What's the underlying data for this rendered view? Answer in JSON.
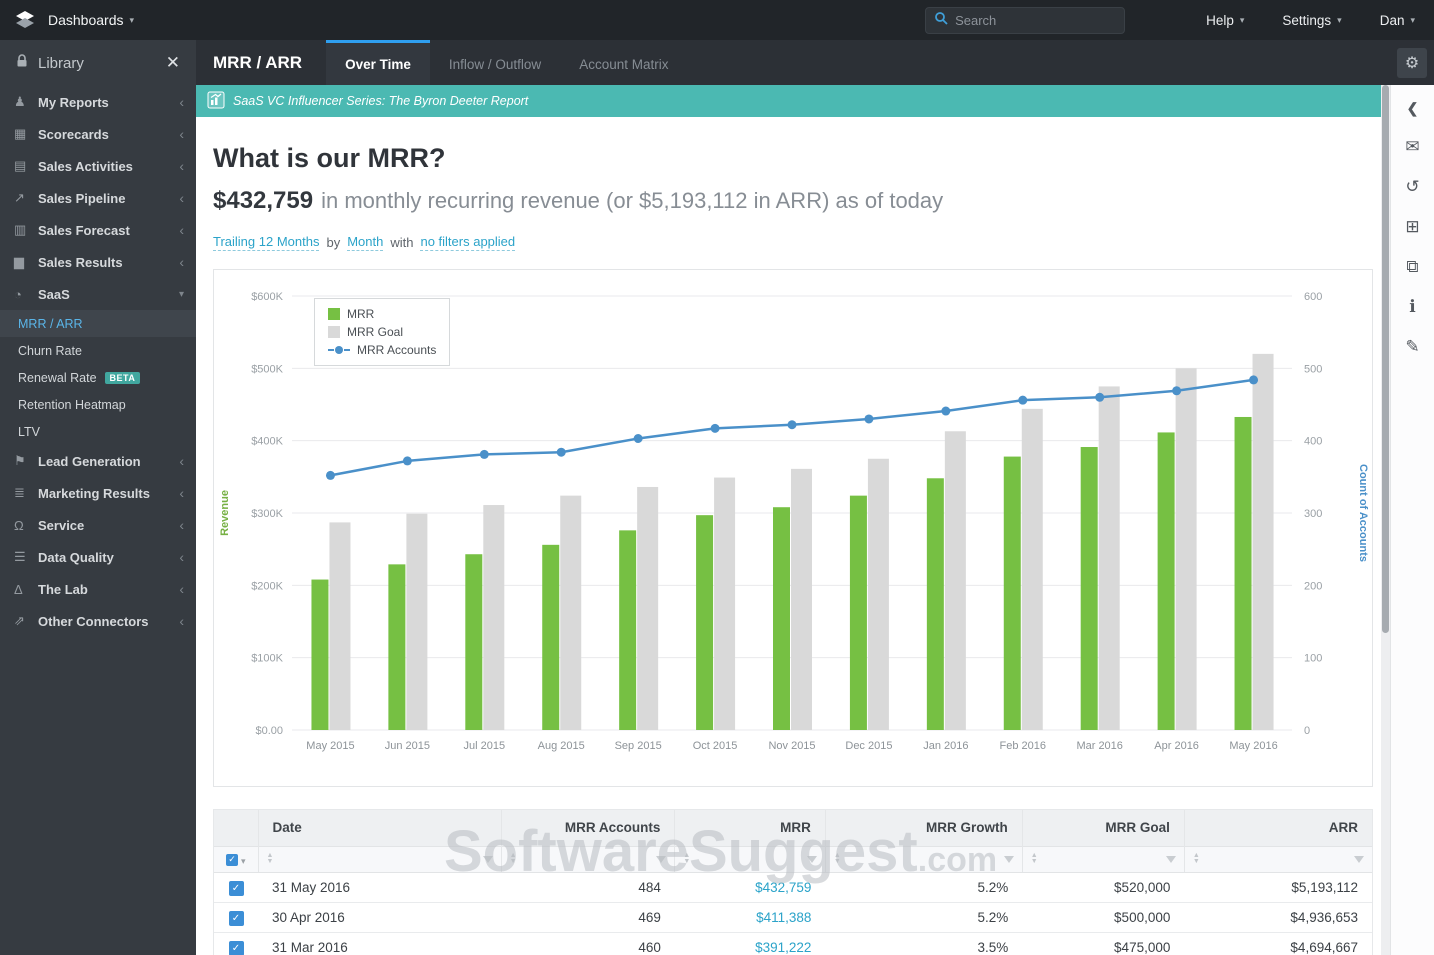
{
  "topbar": {
    "brand": "Dashboards",
    "search_placeholder": "Search",
    "links": [
      "Help",
      "Settings",
      "Dan"
    ]
  },
  "sidebar": {
    "header": "Library",
    "items_top": [
      {
        "label": "My Reports",
        "icon": "reports"
      },
      {
        "label": "Scorecards",
        "icon": "scorecards"
      },
      {
        "label": "Sales Activities",
        "icon": "activities"
      },
      {
        "label": "Sales Pipeline",
        "icon": "pipeline"
      },
      {
        "label": "Sales Forecast",
        "icon": "forecast"
      },
      {
        "label": "Sales Results",
        "icon": "results"
      }
    ],
    "saas_parent": {
      "label": "SaaS",
      "icon": "saas"
    },
    "saas_children": [
      {
        "label": "MRR / ARR",
        "selected": true
      },
      {
        "label": "Churn Rate"
      },
      {
        "label": "Renewal Rate",
        "badge": "BETA"
      },
      {
        "label": "Retention Heatmap"
      },
      {
        "label": "LTV"
      }
    ],
    "items_bottom": [
      {
        "label": "Lead Generation",
        "icon": "lead-generation"
      },
      {
        "label": "Marketing Results",
        "icon": "marketing"
      },
      {
        "label": "Service",
        "icon": "service"
      },
      {
        "label": "Data Quality",
        "icon": "data-quality"
      },
      {
        "label": "The Lab",
        "icon": "lab"
      },
      {
        "label": "Other Connectors",
        "icon": "connectors"
      }
    ]
  },
  "header": {
    "title": "MRR / ARR",
    "tabs": [
      {
        "label": "Over Time",
        "active": true
      },
      {
        "label": "Inflow / Outflow"
      },
      {
        "label": "Account Matrix"
      }
    ]
  },
  "banner": {
    "text": "SaaS VC Influencer Series: The Byron Deeter Report"
  },
  "page": {
    "heading": "What is our MRR?",
    "mrr_amount": "$432,759",
    "subtitle_rest": "in monthly recurring revenue (or $5,193,112 in ARR) as of today"
  },
  "filters": {
    "range": "Trailing 12 Months",
    "by_label": "by",
    "granularity": "Month",
    "with_label": "with",
    "applied": "no filters applied"
  },
  "chart_data": {
    "type": "bar",
    "categories": [
      "May 2015",
      "Jun 2015",
      "Jul 2015",
      "Aug 2015",
      "Sep 2015",
      "Oct 2015",
      "Nov 2015",
      "Dec 2015",
      "Jan 2016",
      "Feb 2016",
      "Mar 2016",
      "Apr 2016",
      "May 2016"
    ],
    "series": [
      {
        "name": "MRR",
        "type": "bar",
        "axis": "left",
        "color": "#76c043",
        "values": [
          208000,
          229000,
          243000,
          256000,
          276000,
          297000,
          308000,
          324000,
          348000,
          378000,
          391222,
          411388,
          432759
        ]
      },
      {
        "name": "MRR Goal",
        "type": "bar",
        "axis": "left",
        "color": "#d9d9d9",
        "values": [
          287000,
          299000,
          311000,
          324000,
          336000,
          349000,
          361000,
          375000,
          413000,
          444000,
          475000,
          500000,
          520000
        ]
      },
      {
        "name": "MRR Accounts",
        "type": "line",
        "axis": "right",
        "color": "#4a90c9",
        "values": [
          352,
          372,
          381,
          384,
          403,
          417,
          422,
          430,
          441,
          456,
          460,
          469,
          484
        ]
      }
    ],
    "left_axis": {
      "label": "Revenue",
      "label_color": "#76b043",
      "min": 0,
      "max": 600000,
      "ticks": [
        "$0.00",
        "$100K",
        "$200K",
        "$300K",
        "$400K",
        "$500K",
        "$600K"
      ]
    },
    "right_axis": {
      "label": "Count of Accounts",
      "label_color": "#4a90c9",
      "min": 0,
      "max": 600,
      "ticks": [
        "0",
        "100",
        "200",
        "300",
        "400",
        "500",
        "600"
      ]
    },
    "legend": [
      "MRR",
      "MRR Goal",
      "MRR Accounts"
    ],
    "legend_position": "top-left",
    "grid": true
  },
  "table": {
    "columns": [
      "Date",
      "MRR Accounts",
      "MRR",
      "MRR Growth",
      "MRR Goal",
      "ARR"
    ],
    "rows": [
      {
        "checked": true,
        "cells": [
          "31 May 2016",
          "484",
          "$432,759",
          "5.2%",
          "$520,000",
          "$5,193,112"
        ]
      },
      {
        "checked": true,
        "cells": [
          "30 Apr 2016",
          "469",
          "$411,388",
          "5.2%",
          "$500,000",
          "$4,936,653"
        ]
      },
      {
        "checked": true,
        "cells": [
          "31 Mar 2016",
          "460",
          "$391,222",
          "3.5%",
          "$475,000",
          "$4,694,667"
        ]
      }
    ]
  },
  "watermark": {
    "main": "SoftwareSuggest",
    "suffix": ".com"
  },
  "right_toolbar": [
    "collapse-panel",
    "email",
    "history",
    "add-widget",
    "snapshot",
    "info",
    "export"
  ],
  "colors": {
    "accent_blue": "#2f9ff0",
    "banner_teal": "#4bb9b2",
    "link_teal": "#2ba3c9",
    "bar_green": "#76c043",
    "goal_gray": "#d9d9d9",
    "line_blue": "#4a90c9",
    "checkbox_blue": "#3b8ed6"
  }
}
